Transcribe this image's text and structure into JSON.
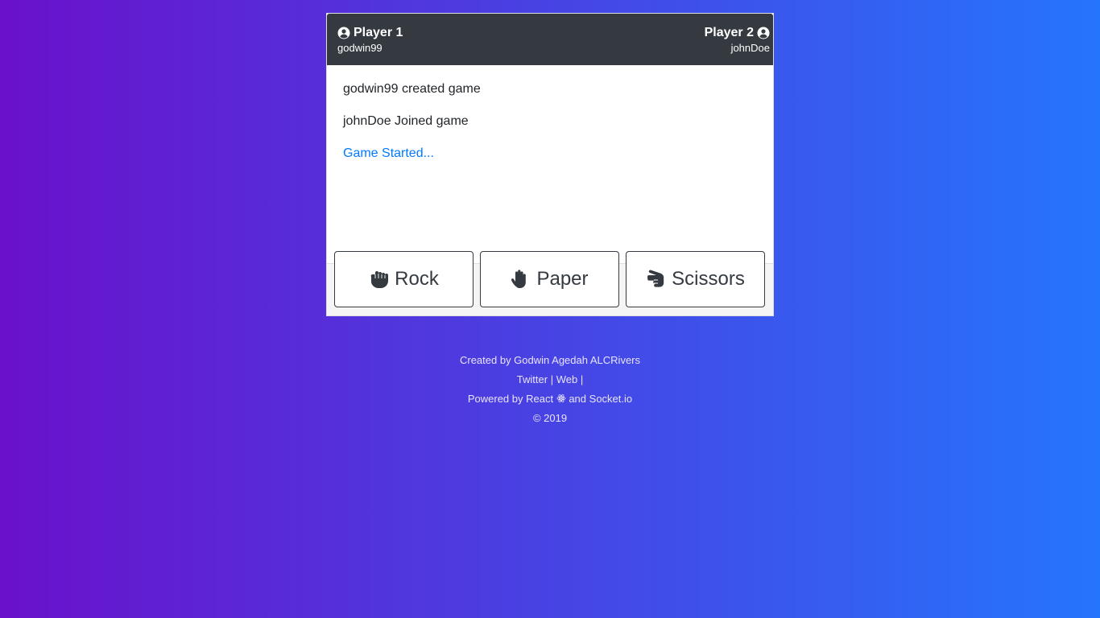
{
  "player1": {
    "title": "Player 1",
    "username": "godwin99"
  },
  "player2": {
    "title": "Player 2",
    "username": "johnDoe"
  },
  "messages": [
    "godwin99 created game",
    "johnDoe Joined game",
    "Game Started..."
  ],
  "choices": [
    {
      "label": "Rock",
      "icon": "hand-rock-icon"
    },
    {
      "label": "Paper",
      "icon": "hand-paper-icon"
    },
    {
      "label": "Scissors",
      "icon": "hand-scissors-icon"
    }
  ],
  "turn": "johnDoe",
  "footer": {
    "credit": "Created by Godwin Agedah ALCRivers",
    "twitter": "Twitter",
    "separator": "|",
    "web": "Web",
    "powered_prefix": "Powered by React",
    "powered_and": "and",
    "socket": "Socket.io",
    "copyright": "© 2019"
  },
  "colors": {
    "header": "#343a40",
    "link": "#007bff",
    "gradient_start": "#6a11cb",
    "gradient_end": "#2575fc"
  }
}
